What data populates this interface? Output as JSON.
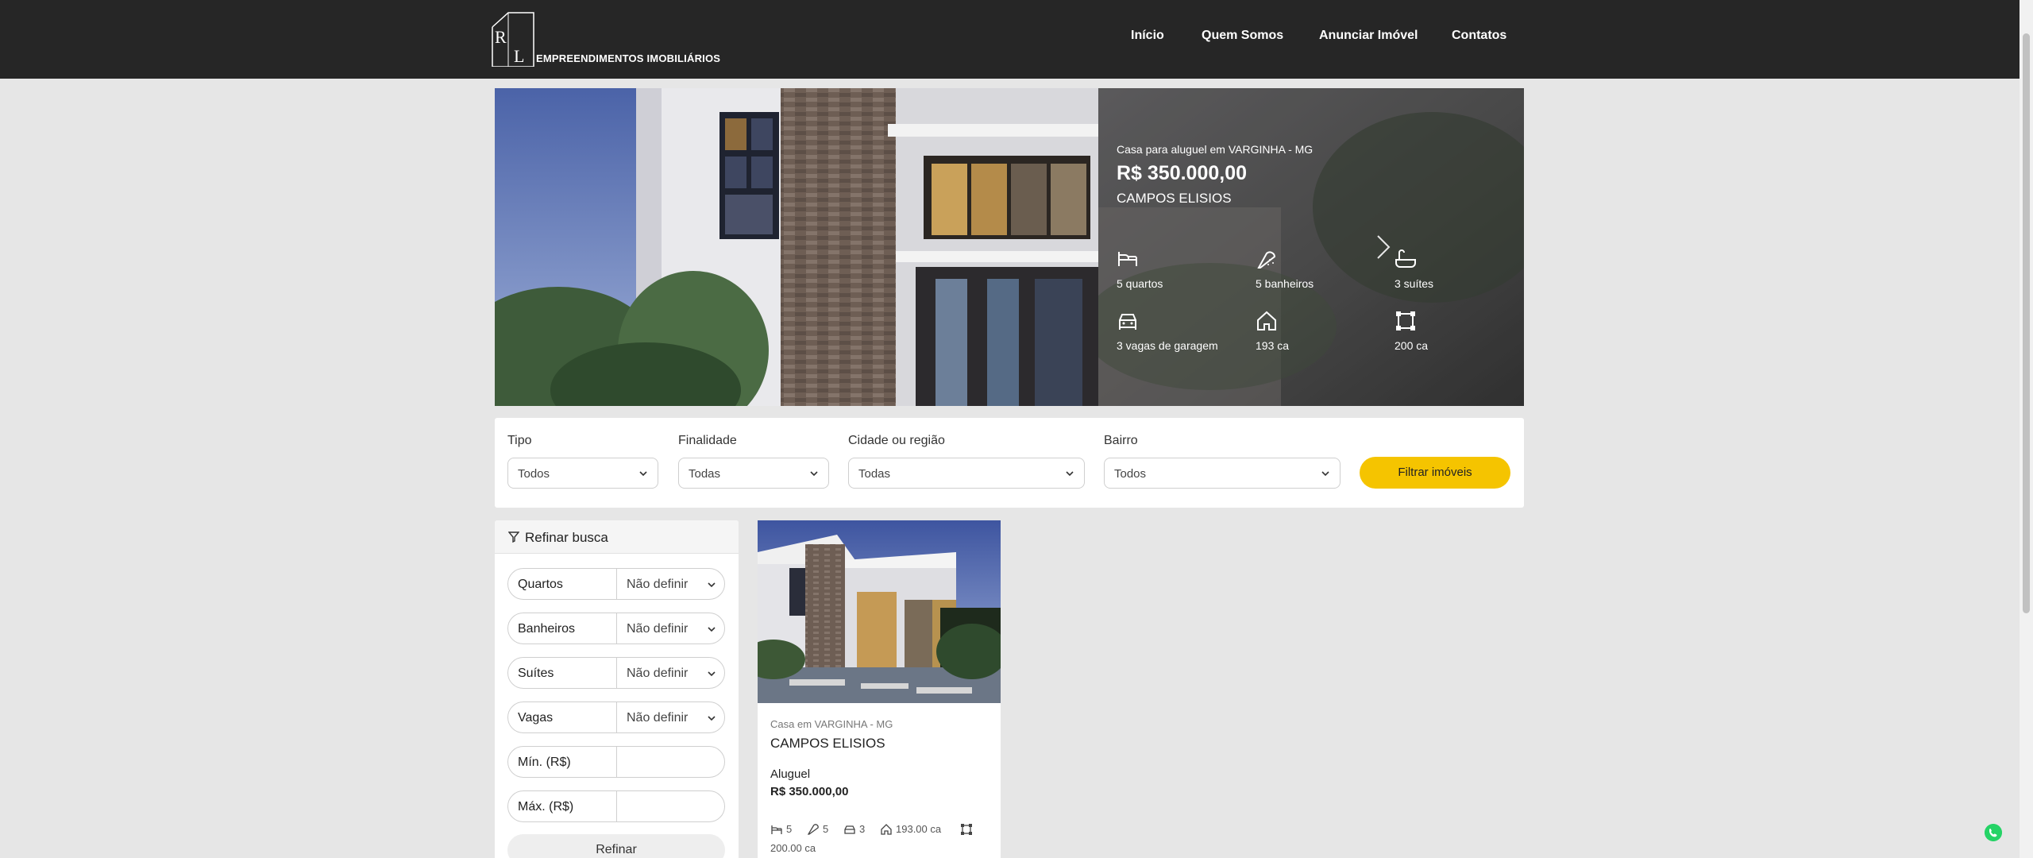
{
  "header": {
    "logo_letters": "RL",
    "logo_text": "EMPREENDIMENTOS IMOBILIÁRIOS",
    "nav": [
      "Início",
      "Quem Somos",
      "Anunciar Imóvel",
      "Contatos"
    ]
  },
  "hero": {
    "subtitle": "Casa para aluguel em VARGINHA - MG",
    "price": "R$ 350.000,00",
    "neighborhood": "CAMPOS ELISIOS",
    "features": [
      {
        "icon": "bed-icon",
        "label": "5 quartos"
      },
      {
        "icon": "shower-icon",
        "label": "5 banheiros"
      },
      {
        "icon": "bathtub-icon",
        "label": "3 suítes"
      },
      {
        "icon": "car-icon",
        "label": "3 vagas de garagem"
      },
      {
        "icon": "house-icon",
        "label": "193 ca"
      },
      {
        "icon": "area-icon",
        "label": "200 ca"
      }
    ]
  },
  "filters": {
    "fields": [
      {
        "label": "Tipo",
        "value": "Todos"
      },
      {
        "label": "Finalidade",
        "value": "Todas"
      },
      {
        "label": "Cidade ou região",
        "value": "Todas"
      },
      {
        "label": "Bairro",
        "value": "Todos"
      }
    ],
    "button": "Filtrar imóveis"
  },
  "refine": {
    "title": "Refinar busca",
    "selects": [
      {
        "label": "Quartos",
        "value": "Não definir"
      },
      {
        "label": "Banheiros",
        "value": "Não definir"
      },
      {
        "label": "Suítes",
        "value": "Não definir"
      },
      {
        "label": "Vagas",
        "value": "Não definir"
      }
    ],
    "inputs": [
      {
        "label": "Mín. (R$)",
        "value": ""
      },
      {
        "label": "Máx. (R$)",
        "value": ""
      }
    ],
    "button": "Refinar"
  },
  "listing": {
    "subtitle": "Casa em VARGINHA - MG",
    "title": "CAMPOS ELISIOS",
    "purpose": "Aluguel",
    "price": "R$ 350.000,00",
    "features": [
      {
        "icon": "bed-icon",
        "value": "5"
      },
      {
        "icon": "shower-icon",
        "value": "5"
      },
      {
        "icon": "car-icon",
        "value": "3"
      },
      {
        "icon": "house-icon",
        "value": "193.00 ca"
      },
      {
        "icon": "area-icon",
        "value": "200.00 ca"
      }
    ]
  },
  "colors": {
    "header_bg": "#262626",
    "accent_yellow": "#f5c400",
    "page_bg": "#e6e6e6",
    "whatsapp": "#25d366"
  }
}
